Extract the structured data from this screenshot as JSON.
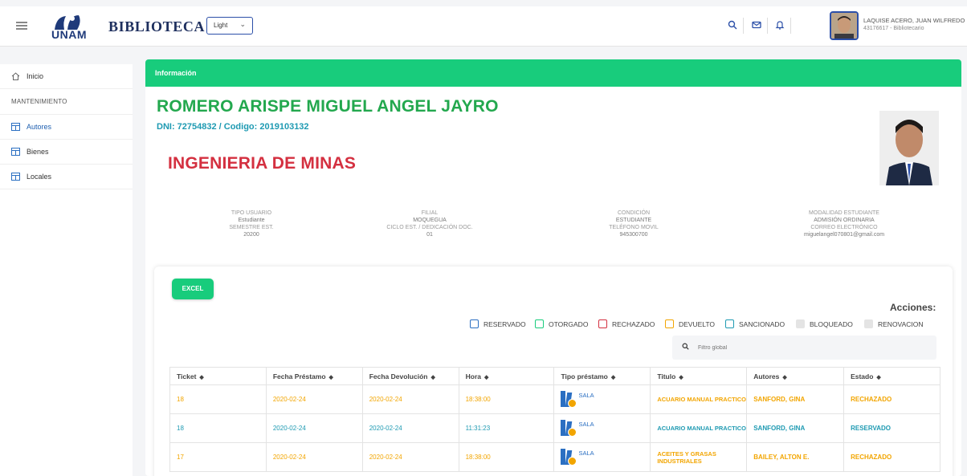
{
  "header": {
    "logo_text": "UNAM",
    "brand": "BIBLIOTECA",
    "theme_select": "Light",
    "user_name": "LAQUISE ACERO, JUAN WILFREDO",
    "user_sub": "43176617 - Bibliotecario",
    "icons": [
      "search-icon",
      "mail-icon",
      "bell-icon"
    ],
    "accent": "#2b4fa8"
  },
  "sidebar": {
    "inicio": "Inicio",
    "section": "MANTENIMIENTO",
    "items": [
      {
        "label": "Autores",
        "active": true
      },
      {
        "label": "Bienes"
      },
      {
        "label": "Locales"
      }
    ]
  },
  "card": {
    "header": "Información",
    "header_color": "#18cc7c",
    "name": "ROMERO ARISPE MIGUEL ANGEL JAYRO",
    "dni_line": "DNI: 72754832 / Codigo: 2019103132",
    "career": "INGENIERIA DE MINAS",
    "info": [
      {
        "l1": "TIPO USUARIO",
        "v1": "Estudiante",
        "l2": "SEMESTRE EST.",
        "v2": "20200"
      },
      {
        "l1": "FILIAL",
        "v1": "MOQUEGUA",
        "l2": "CICLO EST. / DEDICACIÓN DOC.",
        "v2": "01"
      },
      {
        "l1": "CONDICIÓN",
        "v1": "ESTUDIANTE",
        "l2": "TELÉFONO MOVIL",
        "v2": "945300700"
      },
      {
        "l1": "MODALIDAD ESTUDIANTE",
        "v1": "ADMISIÓN ORDINARIA",
        "l2": "CORREO ELECTRÓNICO",
        "v2": "miguelangel070801@gmail.com"
      }
    ]
  },
  "loans": {
    "excel_label": "EXCEL",
    "acciones": "Acciones:",
    "legend": [
      {
        "label": "RESERVADO",
        "color": "#2b6fc2"
      },
      {
        "label": "OTORGADO",
        "color": "#18cc7c"
      },
      {
        "label": "RECHAZADO",
        "color": "#d43040"
      },
      {
        "label": "DEVUELTO",
        "color": "#f2a500"
      },
      {
        "label": "SANCIONADO",
        "color": "#1e9ab2"
      },
      {
        "label": "BLOQUEADO",
        "color": "#dddddd"
      },
      {
        "label": "RENOVACION",
        "color": "#dddddd"
      }
    ],
    "filter_placeholder": "Filtro global",
    "columns": [
      "Ticket",
      "Fecha Préstamo",
      "Fecha Devolución",
      "Hora",
      "Tipo préstamo",
      "Titulo",
      "Autores",
      "Estado"
    ],
    "rows": [
      {
        "ticket": "18",
        "fecha_prestamo": "2020-02-24",
        "fecha_devolucion": "2020-02-24",
        "hora": "18:38:00",
        "tipo": "SALA",
        "titulo": "ACUARIO MANUAL PRACTICO",
        "autores": "SANFORD, GINA",
        "estado": "RECHAZADO"
      },
      {
        "ticket": "18",
        "fecha_prestamo": "2020-02-24",
        "fecha_devolucion": "2020-02-24",
        "hora": "11:31:23",
        "tipo": "SALA",
        "titulo": "ACUARIO MANUAL PRACTICO",
        "autores": "SANFORD, GINA",
        "estado": "RESERVADO"
      },
      {
        "ticket": "17",
        "fecha_prestamo": "2020-02-24",
        "fecha_devolucion": "2020-02-24",
        "hora": "18:38:00",
        "tipo": "SALA",
        "titulo": "ACEITES Y GRASAS INDUSTRIALES",
        "autores": "BAILEY, ALTON E.",
        "estado": "RECHAZADO"
      }
    ]
  }
}
